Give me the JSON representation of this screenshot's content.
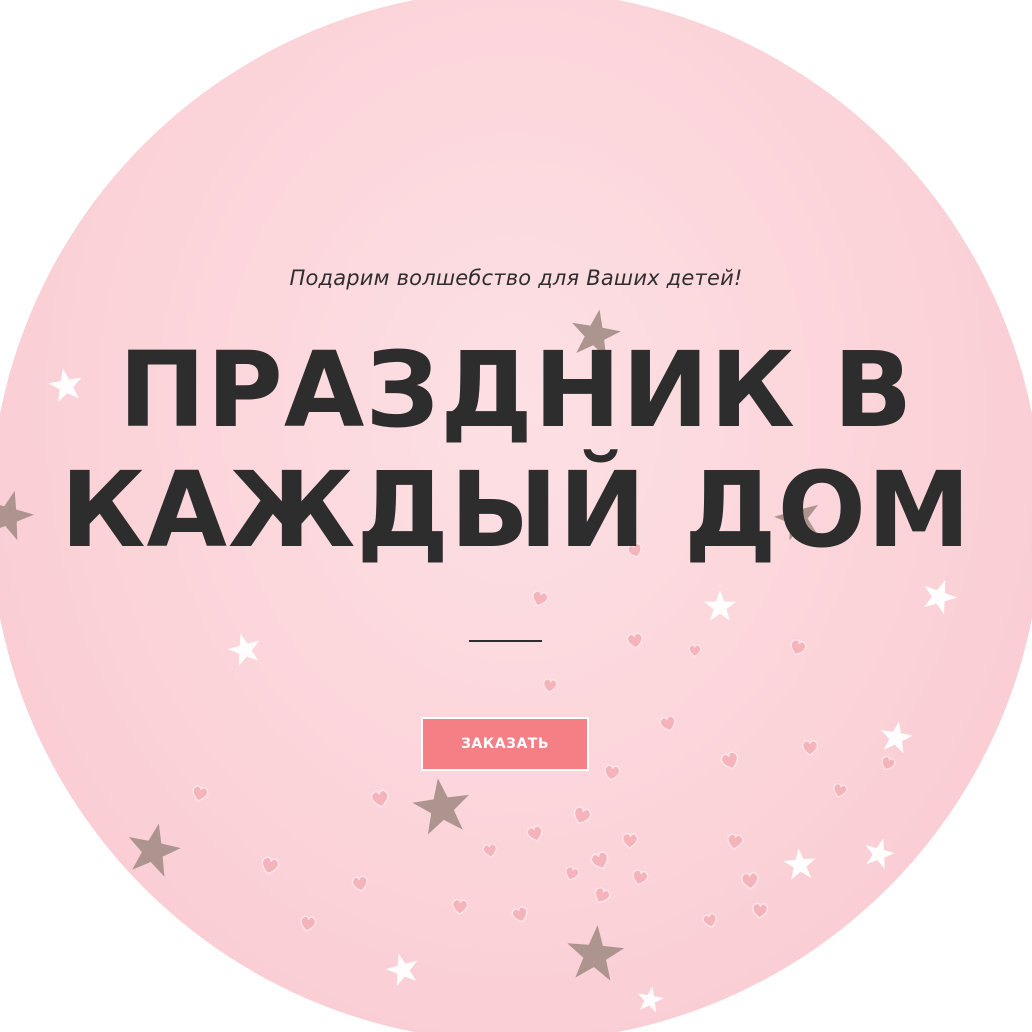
{
  "hero": {
    "subtitle": "Подарим волшебство для Ваших детей!",
    "headline_line1": "ПРАЗДНИК В",
    "headline_line2": "КАЖДЫЙ ДОМ",
    "cta_label": "ЗАКАЗАТЬ"
  },
  "colors": {
    "background": "#fbd3d9",
    "text": "#2d2d2d",
    "button": "#f47f85",
    "button_text": "#ffffff",
    "star_gold": "#a9908a",
    "star_white": "#ffffff",
    "heart_pink": "#f5b3bc"
  },
  "decorations": {
    "stars": "star-icon",
    "hearts": "heart-icon"
  }
}
